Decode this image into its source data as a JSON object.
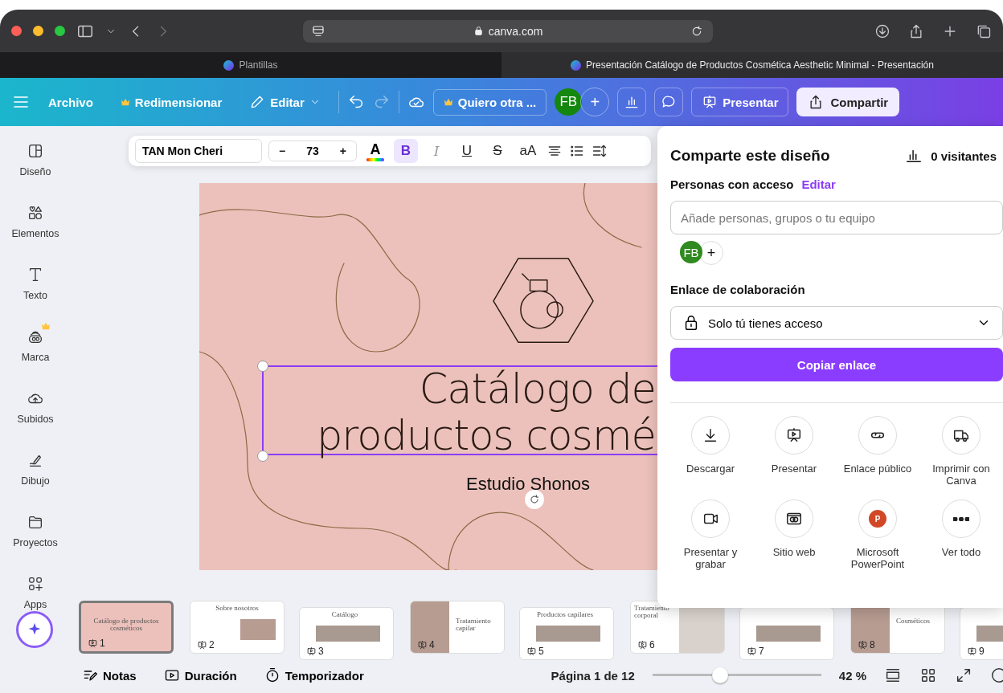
{
  "browser": {
    "address": "canva.com",
    "tabs": [
      {
        "title": "Plantillas",
        "selected": false
      },
      {
        "title": "Presentación Catálogo de Productos Cosmética Aesthetic Minimal - Presentación",
        "selected": true
      }
    ]
  },
  "topbar": {
    "menu": "Archivo",
    "resize": {
      "label": "Redimensionar",
      "premium": true
    },
    "edit": "Editar",
    "alt": {
      "label": "Quiero otra ...",
      "premium": true
    },
    "avatar": "FB",
    "add": "+",
    "present": "Presentar",
    "share": "Compartir"
  },
  "text_toolbar": {
    "font": "TAN Mon Cheri",
    "minus": "−",
    "size": "73",
    "plus": "+",
    "color_button": "A",
    "format_buttons": [
      {
        "label": "B",
        "kind": "bold",
        "selected": true
      },
      {
        "label": "I",
        "kind": "italic",
        "selected": false
      },
      {
        "label": "U",
        "kind": "underline",
        "selected": false
      },
      {
        "label": "S",
        "kind": "strike",
        "selected": false
      },
      {
        "label": "aA",
        "kind": "case",
        "selected": false
      }
    ]
  },
  "sidebar": [
    {
      "label": "Diseño",
      "kind": "layout",
      "premium": false
    },
    {
      "label": "Elementos",
      "kind": "shapes",
      "premium": false
    },
    {
      "label": "Texto",
      "kind": "text",
      "premium": false
    },
    {
      "label": "Marca",
      "kind": "brand",
      "premium": true
    },
    {
      "label": "Subidos",
      "kind": "cloud",
      "premium": false
    },
    {
      "label": "Dibujo",
      "kind": "pen",
      "premium": false
    },
    {
      "label": "Proyectos",
      "kind": "folder",
      "premium": false
    },
    {
      "label": "Apps",
      "kind": "apps",
      "premium": false
    }
  ],
  "slide": {
    "title_lines": [
      "Catálogo de",
      "productos cosmé"
    ],
    "subtitle": "Estudio Shonos"
  },
  "share_panel": {
    "title": "Comparte este diseño",
    "visitors": "0 visitantes",
    "access_label": "Personas con acceso",
    "edit_link": "Editar",
    "placeholder": "Añade personas, grupos o tu equipo",
    "avatar": "FB",
    "add": "+",
    "link_label": "Enlace de colaboración",
    "access_option": "Solo tú tienes acceso",
    "copy_button": "Copiar enlace",
    "actions": [
      {
        "label": "Descargar",
        "kind": "download"
      },
      {
        "label": "Presentar",
        "kind": "present"
      },
      {
        "label": "Enlace público",
        "kind": "link"
      },
      {
        "label": "Imprimir con Canva",
        "kind": "truck"
      },
      {
        "label": "Presentar y grabar",
        "kind": "camera"
      },
      {
        "label": "Sitio web",
        "kind": "web"
      },
      {
        "label": "Microsoft PowerPoint",
        "kind": "logo",
        "logo_letter": "P"
      },
      {
        "label": "Ver todo",
        "kind": "more"
      }
    ]
  },
  "thumbnails": [
    {
      "number": "1",
      "title": "Catálogo de productos cosméticos",
      "kind": "cover",
      "selected": true
    },
    {
      "number": "2",
      "title": "Sobre nosotros",
      "kind": "plain",
      "selected": false
    },
    {
      "number": "3",
      "title": "Catálogo",
      "kind": "grid",
      "selected": false
    },
    {
      "number": "4",
      "title": "Tratamiento capilar",
      "kind": "photo_left",
      "selected": false
    },
    {
      "number": "5",
      "title": "Productos capilares",
      "kind": "grid",
      "selected": false
    },
    {
      "number": "6",
      "title": "Tratamiento corporal",
      "kind": "photo_right",
      "selected": false
    },
    {
      "number": "7",
      "kind": "grid",
      "selected": false
    },
    {
      "number": "8",
      "title": "Cosméticos",
      "kind": "photo_left",
      "selected": false
    },
    {
      "number": "9",
      "kind": "grid",
      "selected": false
    }
  ],
  "bottom_bar": {
    "notes": "Notas",
    "duration": "Duración",
    "timer": "Temporizador",
    "page": "Página 1 de 12",
    "zoom": {
      "level": 0.4,
      "reading": "42 %"
    }
  }
}
